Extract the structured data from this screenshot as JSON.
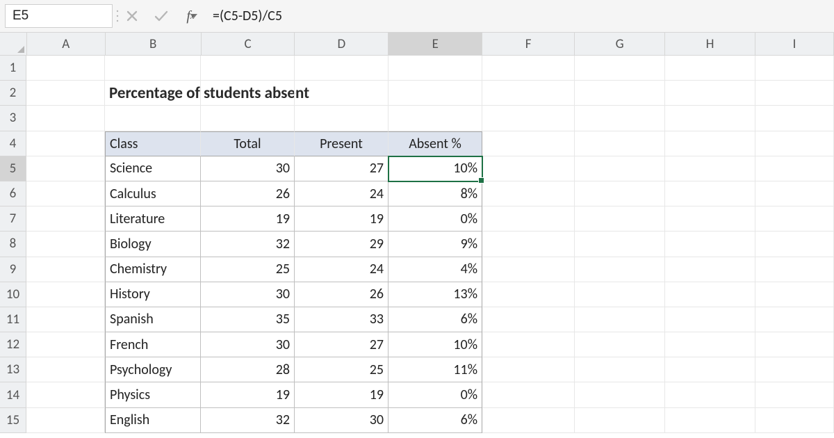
{
  "name_box": "E5",
  "formula": "=(C5-D5)/C5",
  "columns": [
    "A",
    "B",
    "C",
    "D",
    "E",
    "F",
    "G",
    "H",
    "I"
  ],
  "selected_col": "E",
  "selected_row": 5,
  "row_count": 15,
  "title": "Percentage of students absent",
  "headers": {
    "class": "Class",
    "total": "Total",
    "present": "Present",
    "absent": "Absent %"
  },
  "rows": [
    {
      "class": "Science",
      "total": 30,
      "present": 27,
      "absent": "10%"
    },
    {
      "class": "Calculus",
      "total": 26,
      "present": 24,
      "absent": "8%"
    },
    {
      "class": "Literature",
      "total": 19,
      "present": 19,
      "absent": "0%"
    },
    {
      "class": "Biology",
      "total": 32,
      "present": 29,
      "absent": "9%"
    },
    {
      "class": "Chemistry",
      "total": 25,
      "present": 24,
      "absent": "4%"
    },
    {
      "class": "History",
      "total": 30,
      "present": 26,
      "absent": "13%"
    },
    {
      "class": "Spanish",
      "total": 35,
      "present": 33,
      "absent": "6%"
    },
    {
      "class": "French",
      "total": 30,
      "present": 27,
      "absent": "10%"
    },
    {
      "class": "Psychology",
      "total": 28,
      "present": 25,
      "absent": "11%"
    },
    {
      "class": "Physics",
      "total": 19,
      "present": 19,
      "absent": "0%"
    },
    {
      "class": "English",
      "total": 32,
      "present": 30,
      "absent": "6%"
    }
  ],
  "chart_data": {
    "type": "table",
    "title": "Percentage of students absent",
    "columns": [
      "Class",
      "Total",
      "Present",
      "Absent %"
    ],
    "rows": [
      [
        "Science",
        30,
        27,
        "10%"
      ],
      [
        "Calculus",
        26,
        24,
        "8%"
      ],
      [
        "Literature",
        19,
        19,
        "0%"
      ],
      [
        "Biology",
        32,
        29,
        "9%"
      ],
      [
        "Chemistry",
        25,
        24,
        "4%"
      ],
      [
        "History",
        30,
        26,
        "13%"
      ],
      [
        "Spanish",
        35,
        33,
        "6%"
      ],
      [
        "French",
        30,
        27,
        "10%"
      ],
      [
        "Psychology",
        28,
        25,
        "11%"
      ],
      [
        "Physics",
        19,
        19,
        "0%"
      ],
      [
        "English",
        32,
        30,
        "6%"
      ]
    ]
  }
}
